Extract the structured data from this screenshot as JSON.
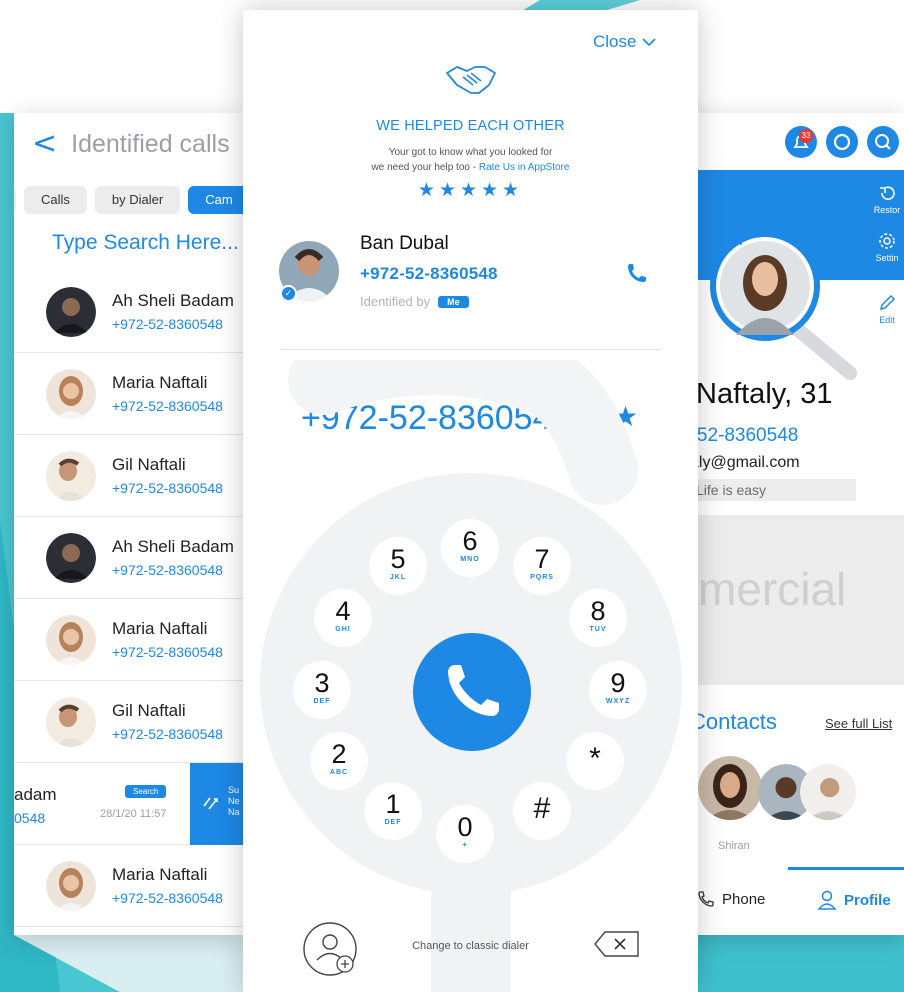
{
  "left_panel": {
    "back_icon": "chevron-left-icon",
    "title": "Identified calls",
    "tabs": [
      "",
      "Calls",
      "by Dialer",
      "Cam"
    ],
    "search_placeholder": "Type Search Here...",
    "contacts": [
      {
        "name": "Ah Sheli Badam",
        "phone": "+972-52-8360548"
      },
      {
        "name": "Maria Naftali",
        "phone": "+972-52-8360548"
      },
      {
        "name": "Gil Naftali",
        "phone": "+972-52-8360548"
      },
      {
        "name": "Ah Sheli Badam",
        "phone": "+972-52-8360548"
      },
      {
        "name": "Maria Naftali",
        "phone": "+972-52-8360548"
      },
      {
        "name": "Gil Naftali",
        "phone": "+972-52-8360548"
      }
    ],
    "swiped_row": {
      "name": "adam",
      "phone": "0548",
      "badge": "Search",
      "date": "28/1/20 11:57",
      "action_lines": [
        "Su",
        "Ne",
        "Na"
      ]
    },
    "last_contact": {
      "name": "Maria Naftali",
      "phone": "+972-52-8360548"
    }
  },
  "center_panel": {
    "close_label": "Close",
    "headline": "WE HELPED EACH OTHER",
    "subline_1": "Your got to know what you looked for",
    "subline_2": "we need your help too - ",
    "rate_link": "Rate Us in AppStore",
    "stars": "★★★★★",
    "caller": {
      "name": "Ban Dubal",
      "phone": "+972-52-8360548",
      "identified_by": "Identified by",
      "identified_badge": "Me"
    },
    "dialed_number": "+972-52-8360548",
    "keys": [
      {
        "digit": "1",
        "letters": "DEF"
      },
      {
        "digit": "2",
        "letters": "ABC"
      },
      {
        "digit": "3",
        "letters": "DEF"
      },
      {
        "digit": "4",
        "letters": "GHI"
      },
      {
        "digit": "5",
        "letters": "JKL"
      },
      {
        "digit": "6",
        "letters": "MNO"
      },
      {
        "digit": "7",
        "letters": "PQRS"
      },
      {
        "digit": "8",
        "letters": "TUV"
      },
      {
        "digit": "9",
        "letters": "WXYZ"
      },
      {
        "digit": "*",
        "letters": ""
      },
      {
        "digit": "0",
        "letters": "+"
      },
      {
        "digit": "#",
        "letters": ""
      }
    ],
    "classic_dialer_label": "Change to classic dialer"
  },
  "right_panel": {
    "notification_count": "33",
    "side_buttons": {
      "restore": "Restor",
      "settings": "Settin",
      "edit": "Edit"
    },
    "name": "Naftaly, 31",
    "phone": "2-52-8360548",
    "email": "aly@gmail.com",
    "status": "Life is easy",
    "commercial_text": "mercial",
    "contacts_title": "Contacts",
    "see_full_list": "See full List",
    "contact_name": "Shiran",
    "tabs": {
      "phone": "Phone",
      "profile": "Profile"
    }
  },
  "colors": {
    "accent": "#1e88e5",
    "teal": "#3fc4cf"
  }
}
